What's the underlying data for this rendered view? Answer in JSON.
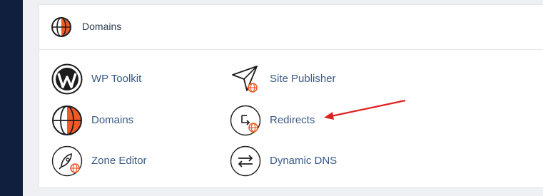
{
  "section": {
    "title": "Domains",
    "header_icon": "globe-icon"
  },
  "tools": [
    {
      "label": "WP Toolkit",
      "icon": "wordpress-icon"
    },
    {
      "label": "Site Publisher",
      "icon": "paper-plane-icon"
    },
    {
      "label": "Domains",
      "icon": "globe-icon"
    },
    {
      "label": "Redirects",
      "icon": "redirect-icon"
    },
    {
      "label": "Zone Editor",
      "icon": "rocket-icon"
    },
    {
      "label": "Dynamic DNS",
      "icon": "swap-arrows-icon"
    }
  ],
  "colors": {
    "accent": "#f05a28",
    "link": "#3a5a86",
    "sidebar": "#0f1f3d",
    "annotation_arrow": "#e02020"
  }
}
